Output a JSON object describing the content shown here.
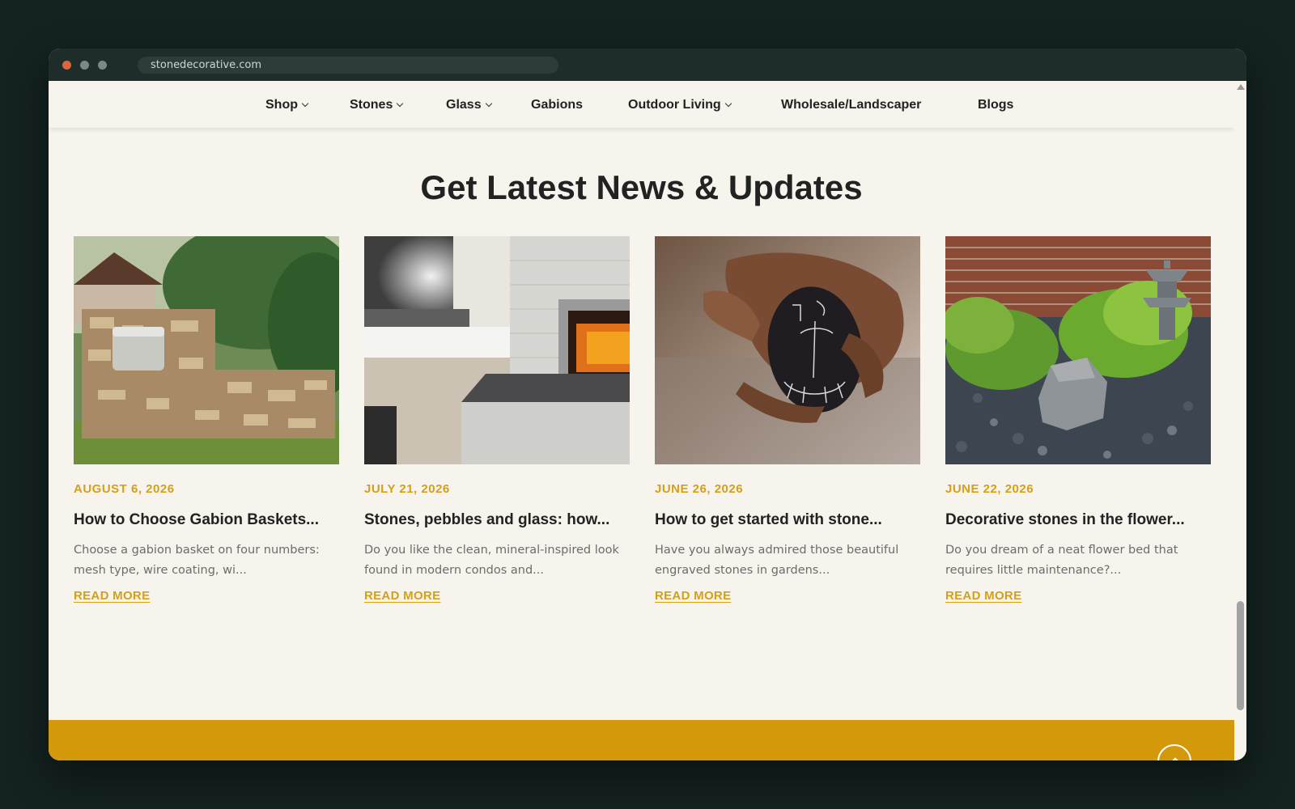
{
  "browser": {
    "url": "stonedecorative.com"
  },
  "nav": {
    "items": [
      {
        "label": "Shop",
        "has_dropdown": true
      },
      {
        "label": "Stones",
        "has_dropdown": true
      },
      {
        "label": "Glass",
        "has_dropdown": true
      },
      {
        "label": "Gabions",
        "has_dropdown": false
      },
      {
        "label": "Outdoor Living",
        "has_dropdown": true
      },
      {
        "label": "Wholesale/Landscaper",
        "has_dropdown": false
      },
      {
        "label": "Blogs",
        "has_dropdown": false
      }
    ]
  },
  "news": {
    "title": "Get Latest News & Updates",
    "read_more_label": "READ MORE",
    "posts": [
      {
        "date": "AUGUST 6, 2026",
        "title": "How to Choose Gabion Baskets...",
        "excerpt": "Choose a gabion basket on four numbers: mesh type, wire coating, wi...",
        "image": "gabion-mailbox-wall"
      },
      {
        "date": "JULY 21, 2026",
        "title": "Stones, pebbles and glass: how...",
        "excerpt": "Do you like the clean, mineral-inspired look found in modern condos and...",
        "image": "stone-fireplace-interior"
      },
      {
        "date": "JUNE 26, 2026",
        "title": "How to get started with stone...",
        "excerpt": "Have you always admired those beautiful engraved stones in gardens...",
        "image": "engraved-stone-in-hand"
      },
      {
        "date": "JUNE 22, 2026",
        "title": "Decorative stones in the flower...",
        "excerpt": "Do you dream of a neat flower bed that requires little maintenance?...",
        "image": "flower-bed-slate-chips"
      }
    ]
  },
  "colors": {
    "accent": "#d4a017",
    "footer": "#d4990a",
    "background": "#f7f4ee",
    "text": "#222222"
  }
}
